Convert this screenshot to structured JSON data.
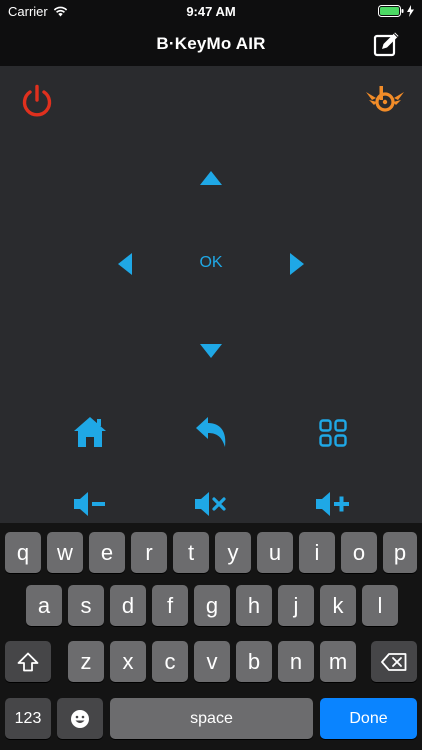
{
  "status_bar": {
    "carrier": "Carrier",
    "time": "9:47 AM"
  },
  "nav": {
    "title": "B·KeyMo AIR"
  },
  "remote": {
    "ok_label": "OK",
    "accent_color": "#1fa8e6",
    "power_color": "#e0301e",
    "logo_color": "#f28c28"
  },
  "keyboard": {
    "row1": [
      "q",
      "w",
      "e",
      "r",
      "t",
      "y",
      "u",
      "i",
      "o",
      "p"
    ],
    "row2": [
      "a",
      "s",
      "d",
      "f",
      "g",
      "h",
      "j",
      "k",
      "l"
    ],
    "row3": [
      "z",
      "x",
      "c",
      "v",
      "b",
      "n",
      "m"
    ],
    "numbers_label": "123",
    "space_label": "space",
    "done_label": "Done"
  }
}
